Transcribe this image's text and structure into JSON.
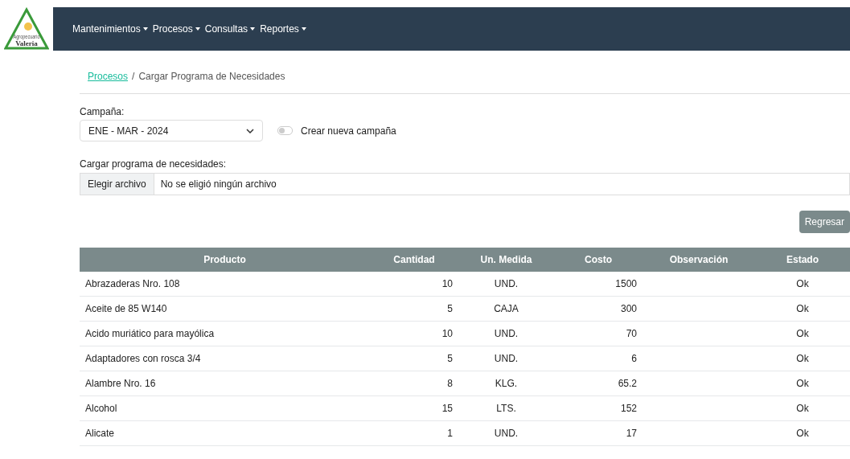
{
  "logo": {
    "subtitle": "Agropecuario",
    "name": "Valeria"
  },
  "nav": [
    {
      "label": "Mantenimientos"
    },
    {
      "label": "Procesos"
    },
    {
      "label": "Consultas"
    },
    {
      "label": "Reportes"
    }
  ],
  "breadcrumb": {
    "link": "Procesos",
    "separator": "/",
    "current": "Cargar Programa de Necesidades"
  },
  "campaign": {
    "label": "Campaña:",
    "value": "ENE - MAR - 2024"
  },
  "new_campaign": {
    "label": "Crear nueva campaña",
    "on": false
  },
  "upload": {
    "label": "Cargar programa de necesidades:",
    "button": "Elegir archivo",
    "status": "No se eligió ningún archivo"
  },
  "back_button": "Regresar",
  "table": {
    "columns": [
      "Producto",
      "Cantidad",
      "Un. Medida",
      "Costo",
      "Observación",
      "Estado"
    ],
    "rows": [
      [
        "Abrazaderas Nro. 108",
        "10",
        "UND.",
        "1500",
        "",
        "Ok"
      ],
      [
        "Aceite de 85 W140",
        "5",
        "CAJA",
        "300",
        "",
        "Ok"
      ],
      [
        "Acido muriático para mayólica",
        "10",
        "UND.",
        "70",
        "",
        "Ok"
      ],
      [
        "Adaptadores con rosca 3/4",
        "5",
        "UND.",
        "6",
        "",
        "Ok"
      ],
      [
        "Alambre Nro. 16",
        "8",
        "KLG.",
        "65.2",
        "",
        "Ok"
      ],
      [
        "Alcohol",
        "15",
        "LTS.",
        "152",
        "",
        "Ok"
      ],
      [
        "Alicate",
        "1",
        "UND.",
        "17",
        "",
        "Ok"
      ]
    ]
  }
}
